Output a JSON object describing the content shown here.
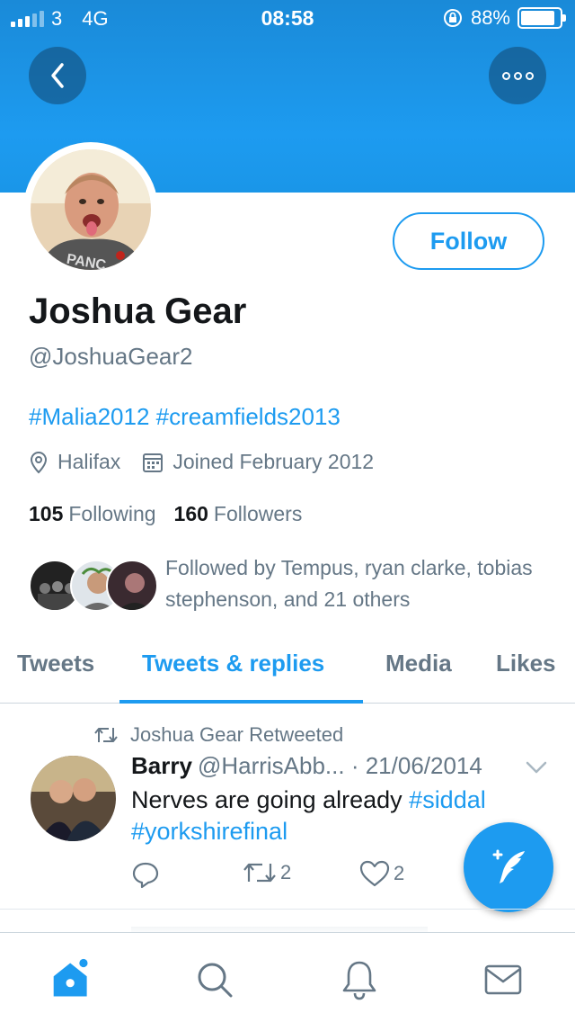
{
  "status_bar": {
    "carrier": "3",
    "network": "4G",
    "time": "08:58",
    "battery": "88%",
    "battery_level": 0.88
  },
  "header": {
    "back_icon": "chevron-left-icon",
    "more_icon": "more-dots-icon"
  },
  "profile": {
    "follow_label": "Follow",
    "name": "Joshua Gear",
    "handle": "@JoshuaGear2",
    "bio": "#Malia2012 #creamfields2013",
    "location": "Halifax",
    "joined": "Joined February 2012",
    "following_count": "105",
    "following_label": "Following",
    "followers_count": "160",
    "followers_label": "Followers",
    "followed_by": "Followed by Tempus, ryan clarke, tobias stephenson, and 21 others"
  },
  "tabs": [
    {
      "label": "Tweets"
    },
    {
      "label": "Tweets & replies"
    },
    {
      "label": "Media"
    },
    {
      "label": "Likes"
    }
  ],
  "tweet": {
    "retweet_label": "Joshua Gear Retweeted",
    "author_name": "Barry",
    "author_handle": "@HarrisAbb...",
    "date": "· 21/06/2014",
    "text_plain": "Nerves are going already ",
    "tag1": "#siddal",
    "tag2": "#yorkshirefinal",
    "retweets": "2",
    "likes": "2"
  },
  "colors": {
    "accent": "#1d9bf0",
    "muted": "#657786",
    "text": "#14171a"
  },
  "bottom_nav": [
    "home-icon",
    "search-icon",
    "notifications-icon",
    "messages-icon"
  ]
}
